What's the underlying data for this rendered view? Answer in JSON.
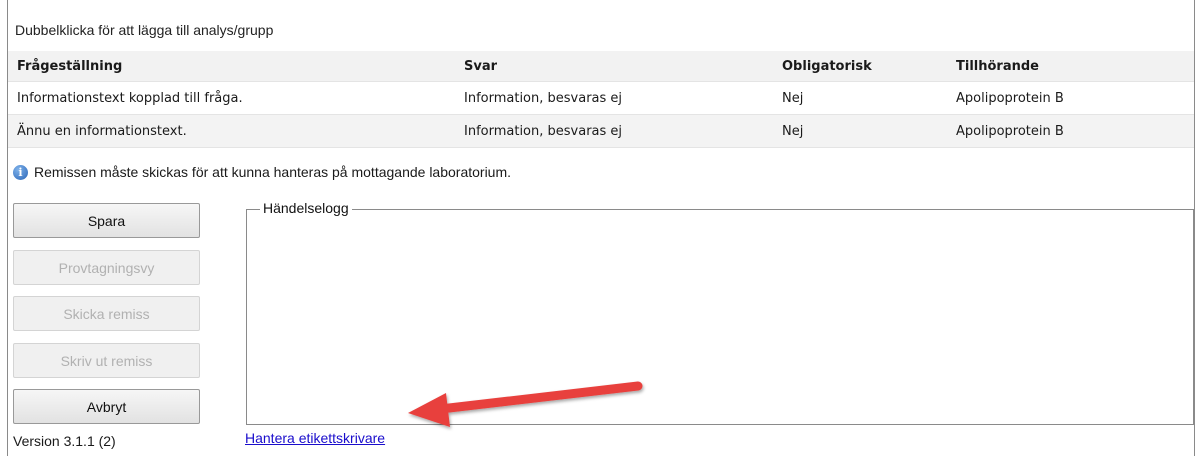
{
  "hint": "Dubbelklicka för att lägga till analys/grupp",
  "table": {
    "headers": [
      "Frågeställning",
      "Svar",
      "Obligatorisk",
      "Tillhörande"
    ],
    "rows": [
      [
        "Informationstext kopplad till fråga.",
        "Information, besvaras ej",
        "Nej",
        "Apolipoprotein B"
      ],
      [
        "Ännu en informationstext.",
        "Information, besvaras ej",
        "Nej",
        "Apolipoprotein B"
      ]
    ]
  },
  "notice": {
    "icon": "info-icon",
    "text": "Remissen måste skickas för att kunna hanteras på mottagande laboratorium."
  },
  "buttons": {
    "spara": "Spara",
    "provtagningsvy": "Provtagningsvy",
    "skicka_remiss": "Skicka remiss",
    "skriv_ut_remiss": "Skriv ut remiss",
    "avbryt": "Avbryt"
  },
  "event_log": {
    "legend": "Händelselogg"
  },
  "version": "Version 3.1.1 (2)",
  "link": "Hantera etikettskrivare",
  "colors": {
    "annotation_arrow": "#e8413d",
    "link": "#1a0dcc"
  }
}
